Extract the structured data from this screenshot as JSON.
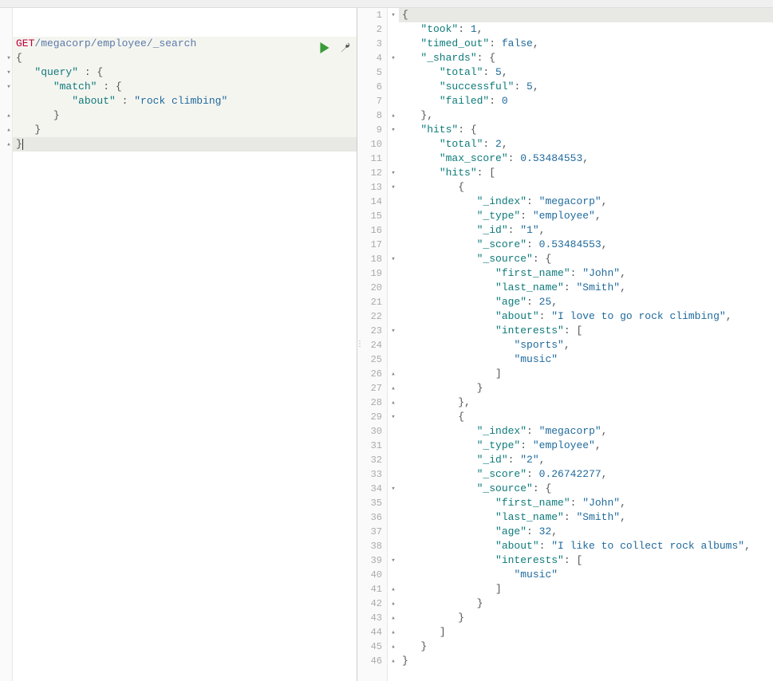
{
  "request": {
    "method": "GET",
    "path": "/megacorp/employee/_search",
    "body_lines": [
      {
        "indent": 0,
        "tokens": [
          {
            "t": "punc",
            "v": "{"
          }
        ]
      },
      {
        "indent": 1,
        "tokens": [
          {
            "t": "key",
            "v": "\"query\""
          },
          {
            "t": "punc",
            "v": " : {"
          }
        ]
      },
      {
        "indent": 2,
        "tokens": [
          {
            "t": "key",
            "v": "\"match\""
          },
          {
            "t": "punc",
            "v": " : {"
          }
        ]
      },
      {
        "indent": 3,
        "tokens": [
          {
            "t": "key",
            "v": "\"about\""
          },
          {
            "t": "punc",
            "v": " : "
          },
          {
            "t": "str",
            "v": "\"rock climbing\""
          }
        ]
      },
      {
        "indent": 2,
        "tokens": [
          {
            "t": "punc",
            "v": "}"
          }
        ]
      },
      {
        "indent": 1,
        "tokens": [
          {
            "t": "punc",
            "v": "}"
          }
        ]
      },
      {
        "indent": 0,
        "tokens": [
          {
            "t": "punc",
            "v": "}"
          }
        ],
        "cursor": true
      }
    ]
  },
  "response_lines": [
    {
      "n": 1,
      "fold": "▾",
      "hl": true,
      "indent": 0,
      "tokens": [
        {
          "t": "punc",
          "v": "{"
        }
      ]
    },
    {
      "n": 2,
      "indent": 1,
      "tokens": [
        {
          "t": "key",
          "v": "\"took\""
        },
        {
          "t": "punc",
          "v": ": "
        },
        {
          "t": "num",
          "v": "1"
        },
        {
          "t": "punc",
          "v": ","
        }
      ]
    },
    {
      "n": 3,
      "indent": 1,
      "tokens": [
        {
          "t": "key",
          "v": "\"timed_out\""
        },
        {
          "t": "punc",
          "v": ": "
        },
        {
          "t": "bool",
          "v": "false"
        },
        {
          "t": "punc",
          "v": ","
        }
      ]
    },
    {
      "n": 4,
      "fold": "▾",
      "indent": 1,
      "tokens": [
        {
          "t": "key",
          "v": "\"_shards\""
        },
        {
          "t": "punc",
          "v": ": {"
        }
      ]
    },
    {
      "n": 5,
      "indent": 2,
      "tokens": [
        {
          "t": "key",
          "v": "\"total\""
        },
        {
          "t": "punc",
          "v": ": "
        },
        {
          "t": "num",
          "v": "5"
        },
        {
          "t": "punc",
          "v": ","
        }
      ]
    },
    {
      "n": 6,
      "indent": 2,
      "tokens": [
        {
          "t": "key",
          "v": "\"successful\""
        },
        {
          "t": "punc",
          "v": ": "
        },
        {
          "t": "num",
          "v": "5"
        },
        {
          "t": "punc",
          "v": ","
        }
      ]
    },
    {
      "n": 7,
      "indent": 2,
      "tokens": [
        {
          "t": "key",
          "v": "\"failed\""
        },
        {
          "t": "punc",
          "v": ": "
        },
        {
          "t": "num",
          "v": "0"
        }
      ]
    },
    {
      "n": 8,
      "fold": "▴",
      "indent": 1,
      "tokens": [
        {
          "t": "punc",
          "v": "},"
        }
      ]
    },
    {
      "n": 9,
      "fold": "▾",
      "indent": 1,
      "tokens": [
        {
          "t": "key",
          "v": "\"hits\""
        },
        {
          "t": "punc",
          "v": ": {"
        }
      ]
    },
    {
      "n": 10,
      "indent": 2,
      "tokens": [
        {
          "t": "key",
          "v": "\"total\""
        },
        {
          "t": "punc",
          "v": ": "
        },
        {
          "t": "num",
          "v": "2"
        },
        {
          "t": "punc",
          "v": ","
        }
      ]
    },
    {
      "n": 11,
      "indent": 2,
      "tokens": [
        {
          "t": "key",
          "v": "\"max_score\""
        },
        {
          "t": "punc",
          "v": ": "
        },
        {
          "t": "num",
          "v": "0.53484553"
        },
        {
          "t": "punc",
          "v": ","
        }
      ]
    },
    {
      "n": 12,
      "fold": "▾",
      "indent": 2,
      "tokens": [
        {
          "t": "key",
          "v": "\"hits\""
        },
        {
          "t": "punc",
          "v": ": ["
        }
      ]
    },
    {
      "n": 13,
      "fold": "▾",
      "indent": 3,
      "tokens": [
        {
          "t": "punc",
          "v": "{"
        }
      ]
    },
    {
      "n": 14,
      "indent": 4,
      "tokens": [
        {
          "t": "key",
          "v": "\"_index\""
        },
        {
          "t": "punc",
          "v": ": "
        },
        {
          "t": "str",
          "v": "\"megacorp\""
        },
        {
          "t": "punc",
          "v": ","
        }
      ]
    },
    {
      "n": 15,
      "indent": 4,
      "tokens": [
        {
          "t": "key",
          "v": "\"_type\""
        },
        {
          "t": "punc",
          "v": ": "
        },
        {
          "t": "str",
          "v": "\"employee\""
        },
        {
          "t": "punc",
          "v": ","
        }
      ]
    },
    {
      "n": 16,
      "indent": 4,
      "tokens": [
        {
          "t": "key",
          "v": "\"_id\""
        },
        {
          "t": "punc",
          "v": ": "
        },
        {
          "t": "str",
          "v": "\"1\""
        },
        {
          "t": "punc",
          "v": ","
        }
      ]
    },
    {
      "n": 17,
      "indent": 4,
      "tokens": [
        {
          "t": "key",
          "v": "\"_score\""
        },
        {
          "t": "punc",
          "v": ": "
        },
        {
          "t": "num",
          "v": "0.53484553"
        },
        {
          "t": "punc",
          "v": ","
        }
      ]
    },
    {
      "n": 18,
      "fold": "▾",
      "indent": 4,
      "tokens": [
        {
          "t": "key",
          "v": "\"_source\""
        },
        {
          "t": "punc",
          "v": ": {"
        }
      ]
    },
    {
      "n": 19,
      "indent": 5,
      "tokens": [
        {
          "t": "key",
          "v": "\"first_name\""
        },
        {
          "t": "punc",
          "v": ": "
        },
        {
          "t": "str",
          "v": "\"John\""
        },
        {
          "t": "punc",
          "v": ","
        }
      ]
    },
    {
      "n": 20,
      "indent": 5,
      "tokens": [
        {
          "t": "key",
          "v": "\"last_name\""
        },
        {
          "t": "punc",
          "v": ": "
        },
        {
          "t": "str",
          "v": "\"Smith\""
        },
        {
          "t": "punc",
          "v": ","
        }
      ]
    },
    {
      "n": 21,
      "indent": 5,
      "tokens": [
        {
          "t": "key",
          "v": "\"age\""
        },
        {
          "t": "punc",
          "v": ": "
        },
        {
          "t": "num",
          "v": "25"
        },
        {
          "t": "punc",
          "v": ","
        }
      ]
    },
    {
      "n": 22,
      "indent": 5,
      "tokens": [
        {
          "t": "key",
          "v": "\"about\""
        },
        {
          "t": "punc",
          "v": ": "
        },
        {
          "t": "str",
          "v": "\"I love to go rock climbing\""
        },
        {
          "t": "punc",
          "v": ","
        }
      ]
    },
    {
      "n": 23,
      "fold": "▾",
      "indent": 5,
      "tokens": [
        {
          "t": "key",
          "v": "\"interests\""
        },
        {
          "t": "punc",
          "v": ": ["
        }
      ]
    },
    {
      "n": 24,
      "indent": 6,
      "tokens": [
        {
          "t": "str",
          "v": "\"sports\""
        },
        {
          "t": "punc",
          "v": ","
        }
      ]
    },
    {
      "n": 25,
      "indent": 6,
      "tokens": [
        {
          "t": "str",
          "v": "\"music\""
        }
      ]
    },
    {
      "n": 26,
      "fold": "▴",
      "indent": 5,
      "tokens": [
        {
          "t": "punc",
          "v": "]"
        }
      ]
    },
    {
      "n": 27,
      "fold": "▴",
      "indent": 4,
      "tokens": [
        {
          "t": "punc",
          "v": "}"
        }
      ]
    },
    {
      "n": 28,
      "fold": "▴",
      "indent": 3,
      "tokens": [
        {
          "t": "punc",
          "v": "},"
        }
      ]
    },
    {
      "n": 29,
      "fold": "▾",
      "indent": 3,
      "tokens": [
        {
          "t": "punc",
          "v": "{"
        }
      ]
    },
    {
      "n": 30,
      "indent": 4,
      "tokens": [
        {
          "t": "key",
          "v": "\"_index\""
        },
        {
          "t": "punc",
          "v": ": "
        },
        {
          "t": "str",
          "v": "\"megacorp\""
        },
        {
          "t": "punc",
          "v": ","
        }
      ]
    },
    {
      "n": 31,
      "indent": 4,
      "tokens": [
        {
          "t": "key",
          "v": "\"_type\""
        },
        {
          "t": "punc",
          "v": ": "
        },
        {
          "t": "str",
          "v": "\"employee\""
        },
        {
          "t": "punc",
          "v": ","
        }
      ]
    },
    {
      "n": 32,
      "indent": 4,
      "tokens": [
        {
          "t": "key",
          "v": "\"_id\""
        },
        {
          "t": "punc",
          "v": ": "
        },
        {
          "t": "str",
          "v": "\"2\""
        },
        {
          "t": "punc",
          "v": ","
        }
      ]
    },
    {
      "n": 33,
      "indent": 4,
      "tokens": [
        {
          "t": "key",
          "v": "\"_score\""
        },
        {
          "t": "punc",
          "v": ": "
        },
        {
          "t": "num",
          "v": "0.26742277"
        },
        {
          "t": "punc",
          "v": ","
        }
      ]
    },
    {
      "n": 34,
      "fold": "▾",
      "indent": 4,
      "tokens": [
        {
          "t": "key",
          "v": "\"_source\""
        },
        {
          "t": "punc",
          "v": ": {"
        }
      ]
    },
    {
      "n": 35,
      "indent": 5,
      "tokens": [
        {
          "t": "key",
          "v": "\"first_name\""
        },
        {
          "t": "punc",
          "v": ": "
        },
        {
          "t": "str",
          "v": "\"John\""
        },
        {
          "t": "punc",
          "v": ","
        }
      ]
    },
    {
      "n": 36,
      "indent": 5,
      "tokens": [
        {
          "t": "key",
          "v": "\"last_name\""
        },
        {
          "t": "punc",
          "v": ": "
        },
        {
          "t": "str",
          "v": "\"Smith\""
        },
        {
          "t": "punc",
          "v": ","
        }
      ]
    },
    {
      "n": 37,
      "indent": 5,
      "tokens": [
        {
          "t": "key",
          "v": "\"age\""
        },
        {
          "t": "punc",
          "v": ": "
        },
        {
          "t": "num",
          "v": "32"
        },
        {
          "t": "punc",
          "v": ","
        }
      ]
    },
    {
      "n": 38,
      "indent": 5,
      "tokens": [
        {
          "t": "key",
          "v": "\"about\""
        },
        {
          "t": "punc",
          "v": ": "
        },
        {
          "t": "str",
          "v": "\"I like to collect rock albums\""
        },
        {
          "t": "punc",
          "v": ","
        }
      ]
    },
    {
      "n": 39,
      "fold": "▾",
      "indent": 5,
      "tokens": [
        {
          "t": "key",
          "v": "\"interests\""
        },
        {
          "t": "punc",
          "v": ": ["
        }
      ]
    },
    {
      "n": 40,
      "indent": 6,
      "tokens": [
        {
          "t": "str",
          "v": "\"music\""
        }
      ]
    },
    {
      "n": 41,
      "fold": "▴",
      "indent": 5,
      "tokens": [
        {
          "t": "punc",
          "v": "]"
        }
      ]
    },
    {
      "n": 42,
      "fold": "▴",
      "indent": 4,
      "tokens": [
        {
          "t": "punc",
          "v": "}"
        }
      ]
    },
    {
      "n": 43,
      "fold": "▴",
      "indent": 3,
      "tokens": [
        {
          "t": "punc",
          "v": "}"
        }
      ]
    },
    {
      "n": 44,
      "fold": "▴",
      "indent": 2,
      "tokens": [
        {
          "t": "punc",
          "v": "]"
        }
      ]
    },
    {
      "n": 45,
      "fold": "▴",
      "indent": 1,
      "tokens": [
        {
          "t": "punc",
          "v": "}"
        }
      ]
    },
    {
      "n": 46,
      "fold": "▴",
      "indent": 0,
      "tokens": [
        {
          "t": "punc",
          "v": "}"
        }
      ]
    }
  ],
  "left_fold_markers": [
    {
      "row": 3,
      "glyph": "▾"
    },
    {
      "row": 4,
      "glyph": "▾"
    },
    {
      "row": 5,
      "glyph": "▾"
    },
    {
      "row": 7,
      "glyph": "▴"
    },
    {
      "row": 8,
      "glyph": "▴"
    },
    {
      "row": 9,
      "glyph": "▴"
    }
  ]
}
